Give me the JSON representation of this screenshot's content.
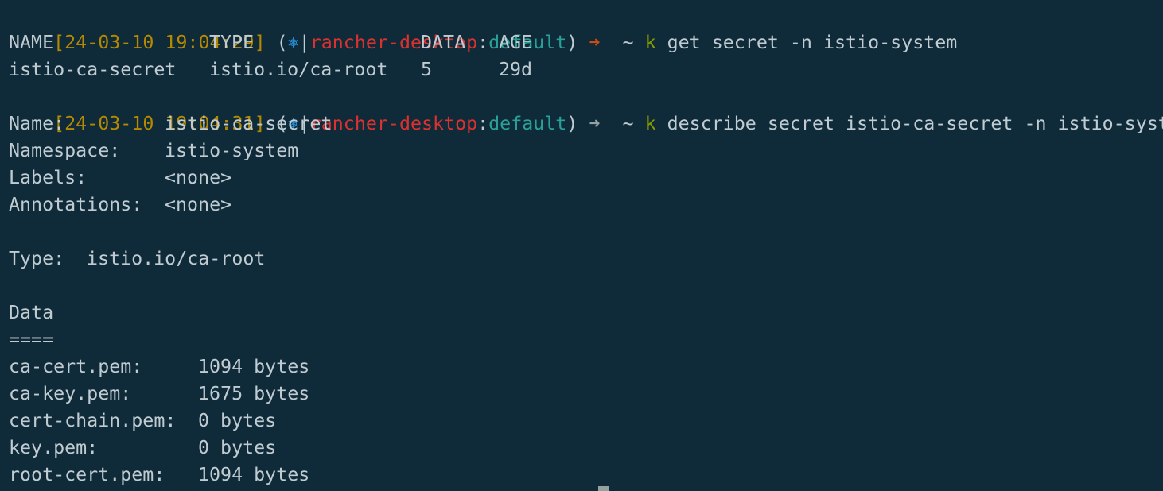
{
  "prompts": [
    {
      "timestamp": "[24-03-10 19:04:29]",
      "open_paren": "(",
      "k8s_icon": "⎈",
      "separator": "|",
      "context": "rancher-desktop",
      "colon": ":",
      "namespace": "default",
      "close_paren": ")",
      "arrow": "➜",
      "tilde": "~",
      "cmd": "k",
      "args": "get secret -n istio-system"
    },
    {
      "timestamp": "[24-03-10 19:04:31]",
      "open_paren": "(",
      "k8s_icon": "⎈",
      "separator": "|",
      "context": "rancher-desktop",
      "colon": ":",
      "namespace": "default",
      "close_paren": ")",
      "arrow": "➜",
      "tilde": "~",
      "cmd": "k",
      "args": "describe secret istio-ca-secret -n istio-system"
    }
  ],
  "get_table": {
    "headers": [
      "NAME",
      "TYPE",
      "DATA",
      "AGE"
    ],
    "rows": [
      [
        "istio-ca-secret",
        "istio.io/ca-root",
        "5",
        "29d"
      ]
    ]
  },
  "describe": {
    "meta": [
      {
        "key": "Name:",
        "value": "istio-ca-secret"
      },
      {
        "key": "Namespace:",
        "value": "istio-system"
      },
      {
        "key": "Labels:",
        "value": "<none>"
      },
      {
        "key": "Annotations:",
        "value": "<none>"
      }
    ],
    "type_key": "Type:",
    "type_value": "istio.io/ca-root",
    "data_heading": "Data",
    "data_rule": "====",
    "data_items": [
      {
        "key": "ca-cert.pem:",
        "value": "1094 bytes"
      },
      {
        "key": "ca-key.pem:",
        "value": "1675 bytes"
      },
      {
        "key": "cert-chain.pem:",
        "value": "0 bytes"
      },
      {
        "key": "key.pem:",
        "value": "0 bytes"
      },
      {
        "key": "root-cert.pem:",
        "value": "1094 bytes"
      }
    ]
  },
  "colors": {
    "background": "#0f2a38",
    "timestamp": "#b58900",
    "k8s_icon": "#268bd2",
    "context": "#dc322f",
    "namespace": "#2aa198",
    "arrow_success": "#cb4b16",
    "arrow_idle": "#93a1a1",
    "cmd": "#859900",
    "text": "#c0ccd2"
  }
}
